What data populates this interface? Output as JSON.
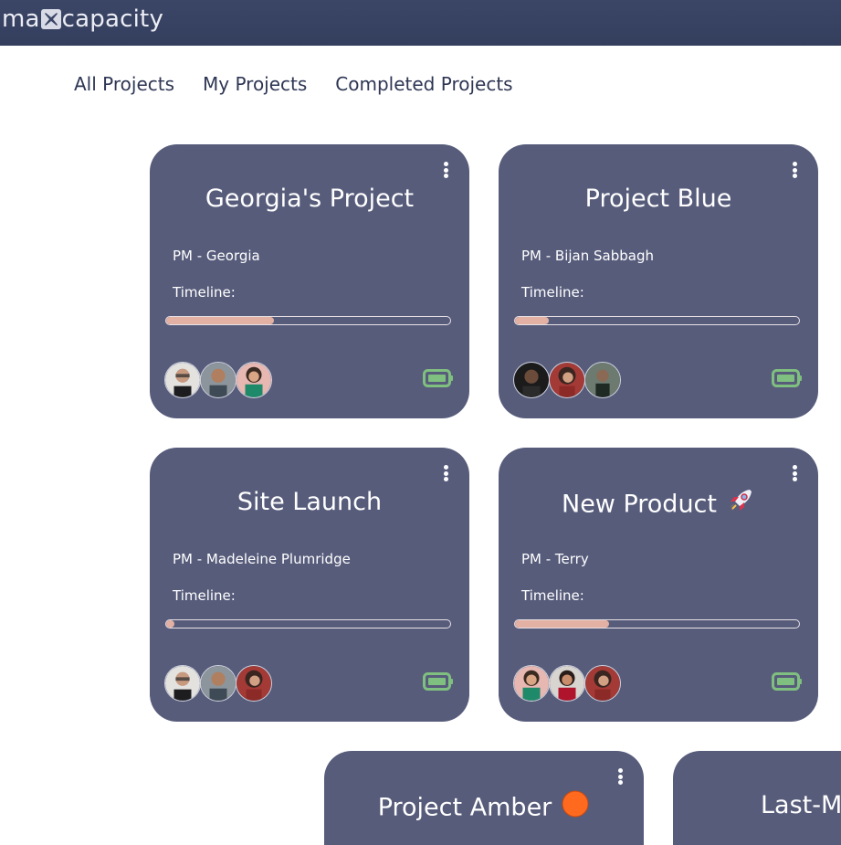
{
  "header": {
    "logo_pre": "ma",
    "logo_post": "capacity",
    "logo_icon": "x-logo-icon"
  },
  "tabs": [
    "All Projects",
    "My Projects",
    "Completed Projects"
  ],
  "colors": {
    "topbar": "#3b4566",
    "card": "#575c7b",
    "progress_fill": "#e3b0a4",
    "battery": "#7fbf7f",
    "amber_dot": "#ff6a1f"
  },
  "cards": [
    {
      "title": "Georgia's Project",
      "pm": "PM - Georgia",
      "timeline_label": "Timeline:",
      "progress": 0.38,
      "avatars": [
        "avatar-man-glasses",
        "avatar-man-smiling",
        "avatar-woman-curly-hair"
      ],
      "capacity_icon": "battery-full-icon"
    },
    {
      "title": "Project Blue",
      "pm": "PM - Bijan Sabbagh",
      "timeline_label": "Timeline:",
      "progress": 0.12,
      "avatars": [
        "avatar-dark-portrait",
        "avatar-woman-red",
        "avatar-man-outdoor"
      ],
      "capacity_icon": "battery-full-icon"
    },
    {
      "title": "Site Launch",
      "pm": "PM - Madeleine Plumridge",
      "timeline_label": "Timeline:",
      "progress": 0.03,
      "avatars": [
        "avatar-man-glasses",
        "avatar-man-smiling",
        "avatar-woman-red"
      ],
      "capacity_icon": "battery-full-icon"
    },
    {
      "title": "New Product",
      "title_icon": "rocket-icon",
      "pm": "PM - Terry",
      "timeline_label": "Timeline:",
      "progress": 0.33,
      "avatars": [
        "avatar-woman-curly-hair",
        "avatar-woman-red-top",
        "avatar-woman-red"
      ],
      "capacity_icon": "battery-full-icon"
    },
    {
      "title": "Project Amber",
      "title_icon": "orange-dot-icon"
    },
    {
      "title": "Last-Mi"
    }
  ]
}
